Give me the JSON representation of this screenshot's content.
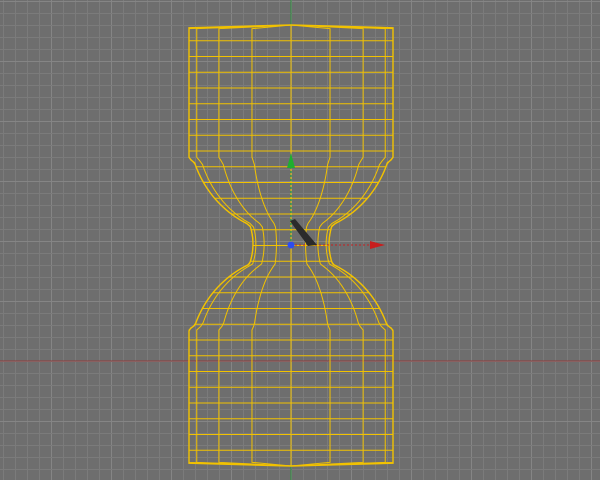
{
  "viewport": {
    "view": "front",
    "background_color": "#6e6e6e",
    "grid": {
      "visible": true,
      "minor_color": "#7b7b7b",
      "major_color": "#858585",
      "origin_x_axis_color": "#8f3a3a",
      "origin_y_axis_color": "#2f8f3f"
    },
    "object": {
      "display_mode": "wireframe",
      "selected": true,
      "wire_color": "#f2c200",
      "shape": "dumbbell-lathe",
      "profile_segments": 28,
      "meridians": 16
    },
    "gizmo": {
      "type": "move",
      "x_axis_color": "#c81e1e",
      "y_axis_color": "#1fae2e",
      "z_axis_color": "#2d4cf0",
      "pivot_marker_color": "#2d4cf0",
      "handle_color": "#2b2b2b"
    }
  }
}
